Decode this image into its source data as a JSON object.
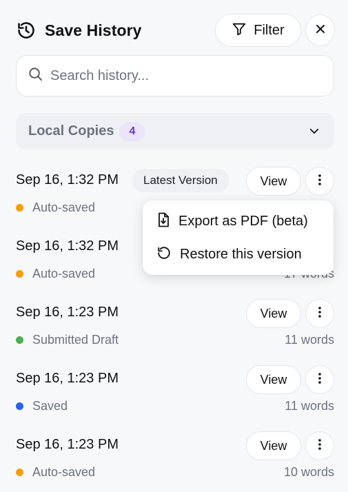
{
  "header": {
    "title": "Save History",
    "filter_label": "Filter"
  },
  "search": {
    "placeholder": "Search history...",
    "value": ""
  },
  "local_copies": {
    "label": "Local Copies",
    "count": "4"
  },
  "menu": {
    "items": [
      {
        "label": "Export as PDF (beta)",
        "icon": "file-download-icon"
      },
      {
        "label": "Restore this version",
        "icon": "restore-icon"
      }
    ]
  },
  "rows": [
    {
      "date": "Sep 16, 1:32 PM",
      "badge": "Latest Version",
      "view_label": "View",
      "status": "Auto-saved",
      "status_color": "#f59e0b",
      "words": ""
    },
    {
      "date": "Sep 16, 1:32 PM",
      "badge": "",
      "view_label": "View",
      "status": "Auto-saved",
      "status_color": "#f59e0b",
      "words": "17 words"
    },
    {
      "date": "Sep 16, 1:23 PM",
      "badge": "",
      "view_label": "View",
      "status": "Submitted Draft",
      "status_color": "#4caf50",
      "words": "11 words"
    },
    {
      "date": "Sep 16, 1:23 PM",
      "badge": "",
      "view_label": "View",
      "status": "Saved",
      "status_color": "#2563eb",
      "words": "11 words"
    },
    {
      "date": "Sep 16, 1:23 PM",
      "badge": "",
      "view_label": "View",
      "status": "Auto-saved",
      "status_color": "#f59e0b",
      "words": "10 words"
    }
  ],
  "colors": {
    "accent_purple": "#6b35d6",
    "auto_saved": "#f59e0b",
    "submitted": "#4caf50",
    "saved": "#2563eb"
  }
}
